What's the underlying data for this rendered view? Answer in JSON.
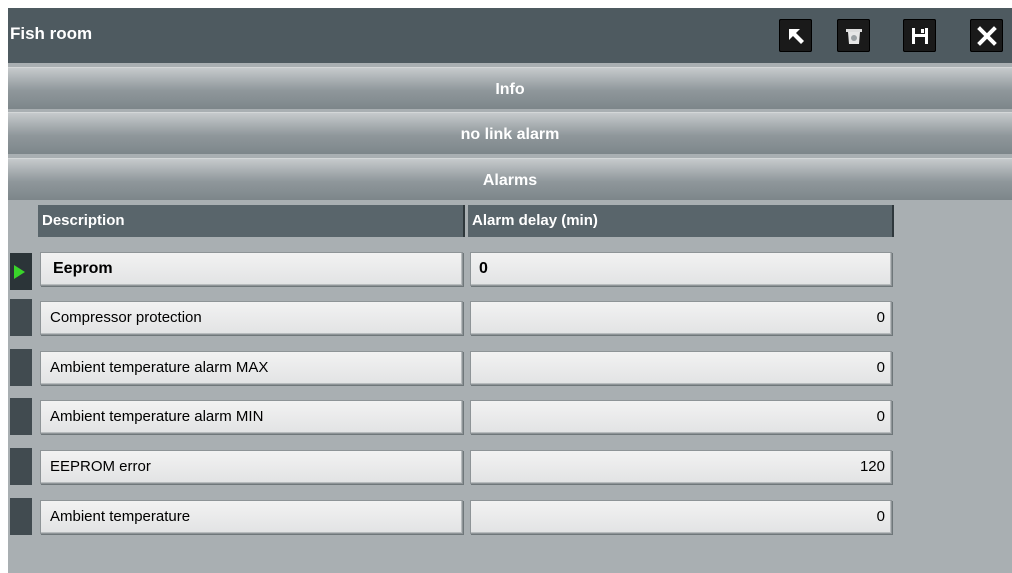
{
  "window": {
    "title": "Fish room",
    "buttons": [
      {
        "name": "back-button",
        "icon": "undo-arrow-icon"
      },
      {
        "name": "delete-button",
        "icon": "trash-icon"
      },
      {
        "name": "save-button",
        "icon": "floppy-disk-icon"
      },
      {
        "name": "close-button",
        "icon": "close-x-icon"
      }
    ]
  },
  "sections": {
    "info": "Info",
    "no_link_alarm": "no link alarm",
    "alarms": "Alarms"
  },
  "table": {
    "headers": {
      "description": "Description",
      "alarm_delay": "Alarm delay (min)"
    },
    "rows": [
      {
        "description": "Eeprom",
        "delay": "0",
        "active": true
      },
      {
        "description": "Compressor protection",
        "delay": "0",
        "active": false
      },
      {
        "description": "Ambient temperature alarm MAX",
        "delay": "0",
        "active": false
      },
      {
        "description": "Ambient temperature alarm MIN",
        "delay": "0",
        "active": false
      },
      {
        "description": "EEPROM error",
        "delay": "120",
        "active": false
      },
      {
        "description": "Ambient temperature",
        "delay": "0",
        "active": false
      }
    ]
  },
  "colors": {
    "titlebar": "#4e5a60",
    "background": "#a9afb2",
    "header": "#59656b",
    "active_indicator": "#39d42a"
  }
}
